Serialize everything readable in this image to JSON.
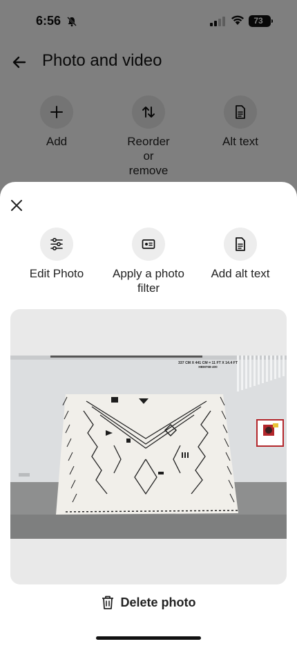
{
  "status_bar": {
    "time": "6:56",
    "battery": "73"
  },
  "background_screen": {
    "title": "Photo and video",
    "actions": [
      {
        "label": "Add",
        "icon": "plus-icon"
      },
      {
        "label": "Reorder\nor\nremove",
        "icon": "reorder-icon"
      },
      {
        "label": "Alt text",
        "icon": "document-icon"
      }
    ]
  },
  "sheet": {
    "actions": [
      {
        "label": "Edit Photo",
        "icon": "sliders-icon"
      },
      {
        "label": "Apply a photo filter",
        "icon": "photo-filter-icon"
      },
      {
        "label": "Add alt text",
        "icon": "document-icon"
      }
    ],
    "photo_caption_line1": "337 CM X 441 CM = 11 FT X 14.4 FT",
    "photo_caption_line2": "HBM768-400",
    "delete_label": "Delete photo"
  }
}
